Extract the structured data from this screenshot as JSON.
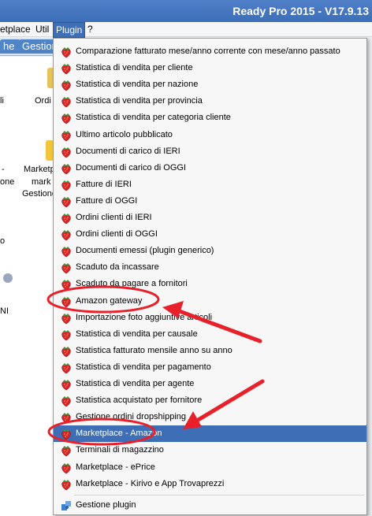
{
  "window": {
    "title": "Ready Pro 2015 - V17.9.13"
  },
  "menubar": {
    "items": [
      "etplace",
      "Util",
      "Plugin",
      "?"
    ]
  },
  "tabs": [
    "he",
    "Gestion"
  ],
  "background_labels": [
    "li",
    "Ordi",
    "-",
    "Marketp",
    "one",
    "mark",
    "Gestione",
    "o",
    "NI"
  ],
  "plugin_menu": {
    "items": [
      "Comparazione fatturato mese/anno corrente con mese/anno passato",
      "Statistica di vendita per cliente",
      "Statistica di vendita per nazione",
      "Statistica di vendita per provincia",
      "Statistica di vendita per categoria cliente",
      "Ultimo articolo pubblicato",
      "Documenti di carico di IERI",
      "Documenti di carico di OGGI",
      "Fatture di IERI",
      "Fatture di OGGI",
      "Ordini clienti di IERI",
      "Ordini clienti di OGGI",
      "Documenti emessi (plugin generico)",
      "Scaduto da incassare",
      "Scaduto da pagare a fornitori",
      "Amazon gateway",
      "Importazione foto aggiuntive articoli",
      "Statistica di vendita per causale",
      "Statistica fatturato mensile anno su anno",
      "Statistica di vendita per pagamento",
      "Statistica di vendita per agente",
      "Statistica acquistato per fornitore",
      "Gestione ordini dropshipping",
      "Marketplace - Amazon",
      "Terminali di magazzino",
      "Marketplace - ePrice",
      "Marketplace - Kirivo e App Trovaprezzi"
    ],
    "highlighted": "Marketplace - Amazon",
    "footer_item": "Gestione plugin",
    "item_icon": "strawberry-icon",
    "footer_icon": "puzzle-icon"
  },
  "colors": {
    "titlebar": "#3b6db8",
    "highlight": "#3e6fb6",
    "annotation": "#e8202a"
  }
}
